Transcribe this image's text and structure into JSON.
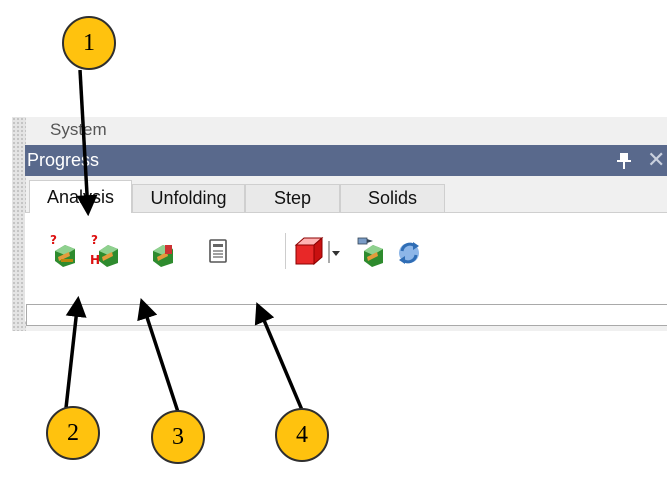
{
  "panel": {
    "system_label": "System",
    "title": "Progress",
    "pin_icon": "pin-icon",
    "close_icon": "close-icon",
    "close_glyph": "✕"
  },
  "tabs": [
    {
      "label": "Analysis",
      "active": true
    },
    {
      "label": "Unfolding",
      "active": false
    },
    {
      "label": "Step",
      "active": false
    },
    {
      "label": "Solids",
      "active": false
    }
  ],
  "toolbar": {
    "tools": [
      {
        "name": "analyze-unfoldability-icon"
      },
      {
        "name": "analyze-unfoldability-highlight-icon"
      },
      {
        "name": "analysis-results-icon"
      },
      {
        "name": "analysis-report-icon"
      },
      {
        "name": "solid-view-icon"
      },
      {
        "name": "dropdown-arrow-icon"
      },
      {
        "name": "transfer-geometry-icon"
      },
      {
        "name": "refresh-icon"
      }
    ]
  },
  "callouts": [
    "1",
    "2",
    "3",
    "4"
  ],
  "colors": {
    "title_bar": "#59698c",
    "callout_fill": "#ffc20e",
    "panel_bg": "#f0f0f0"
  }
}
